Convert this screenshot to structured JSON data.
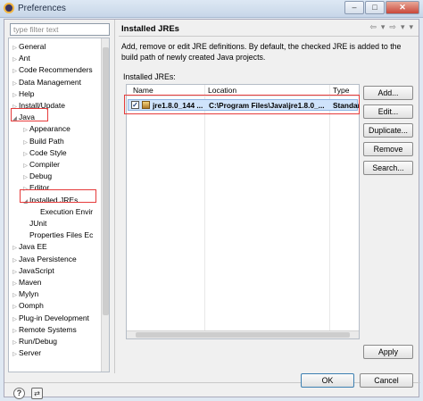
{
  "window": {
    "title": "Preferences"
  },
  "window_controls": {
    "minimize": "–",
    "maximize": "□",
    "close": "✕"
  },
  "filter": {
    "placeholder": "type filter text"
  },
  "tree": [
    {
      "label": "General",
      "arrow": "▷",
      "indent": 0
    },
    {
      "label": "Ant",
      "arrow": "▷",
      "indent": 0
    },
    {
      "label": "Code Recommenders",
      "arrow": "▷",
      "indent": 0
    },
    {
      "label": "Data Management",
      "arrow": "▷",
      "indent": 0
    },
    {
      "label": "Help",
      "arrow": "▷",
      "indent": 0
    },
    {
      "label": "Install/Update",
      "arrow": "▷",
      "indent": 0
    },
    {
      "label": "Java",
      "arrow": "◢",
      "indent": 0
    },
    {
      "label": "Appearance",
      "arrow": "▷",
      "indent": 1
    },
    {
      "label": "Build Path",
      "arrow": "▷",
      "indent": 1
    },
    {
      "label": "Code Style",
      "arrow": "▷",
      "indent": 1
    },
    {
      "label": "Compiler",
      "arrow": "▷",
      "indent": 1
    },
    {
      "label": "Debug",
      "arrow": "▷",
      "indent": 1
    },
    {
      "label": "Editor",
      "arrow": "▷",
      "indent": 1
    },
    {
      "label": "Installed JREs",
      "arrow": "◢",
      "indent": 1
    },
    {
      "label": "Execution Envir",
      "arrow": "",
      "indent": 2
    },
    {
      "label": "JUnit",
      "arrow": "",
      "indent": 1
    },
    {
      "label": "Properties Files Ec",
      "arrow": "",
      "indent": 1
    },
    {
      "label": "Java EE",
      "arrow": "▷",
      "indent": 0
    },
    {
      "label": "Java Persistence",
      "arrow": "▷",
      "indent": 0
    },
    {
      "label": "JavaScript",
      "arrow": "▷",
      "indent": 0
    },
    {
      "label": "Maven",
      "arrow": "▷",
      "indent": 0
    },
    {
      "label": "Mylyn",
      "arrow": "▷",
      "indent": 0
    },
    {
      "label": "Oomph",
      "arrow": "▷",
      "indent": 0
    },
    {
      "label": "Plug-in Development",
      "arrow": "▷",
      "indent": 0
    },
    {
      "label": "Remote Systems",
      "arrow": "▷",
      "indent": 0
    },
    {
      "label": "Run/Debug",
      "arrow": "▷",
      "indent": 0
    },
    {
      "label": "Server",
      "arrow": "▷",
      "indent": 0
    }
  ],
  "page": {
    "title": "Installed JREs",
    "nav": [
      "⇦",
      "▾",
      "⇨",
      "▾",
      "▾"
    ],
    "description": "Add, remove or edit JRE definitions. By default, the checked JRE is added to the build path of newly created Java projects.",
    "list_label": "Installed JREs:"
  },
  "table": {
    "columns": [
      "Name",
      "Location",
      "Type"
    ],
    "rows": [
      {
        "checked": "✓",
        "name": "jre1.8.0_144 ...",
        "location": "C:\\Program Files\\Java\\jre1.8.0_...",
        "type": "Standar"
      }
    ]
  },
  "buttons": {
    "add": "Add...",
    "edit": "Edit...",
    "duplicate": "Duplicate...",
    "remove": "Remove",
    "search": "Search...",
    "apply": "Apply",
    "ok": "OK",
    "cancel": "Cancel"
  },
  "footer_icons": {
    "help": "?",
    "import_export": "⇄"
  },
  "colors": {
    "annotation": "#e63b3b",
    "selection": "#cfe3fb"
  }
}
